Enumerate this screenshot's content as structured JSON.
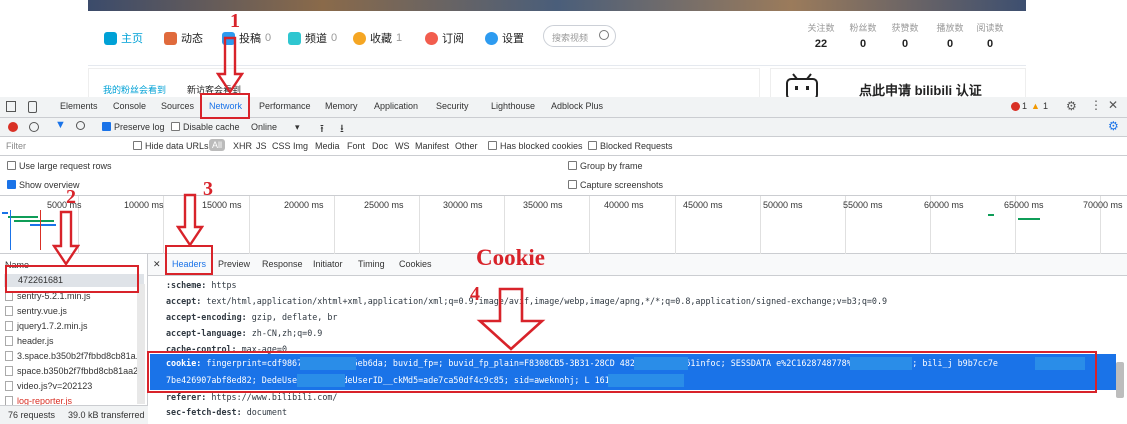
{
  "site": {
    "nav": [
      {
        "label": "主页",
        "count": "",
        "color": "#00a1d6",
        "icon": "home-icon"
      },
      {
        "label": "动态",
        "count": "",
        "color": "#e06a3c",
        "icon": "dynamic-icon"
      },
      {
        "label": "投稿",
        "count": "0",
        "color": "#2d9bf0",
        "icon": "upload-icon"
      },
      {
        "label": "频道",
        "count": "0",
        "color": "#2fc6d0",
        "icon": "channel-icon"
      },
      {
        "label": "收藏",
        "count": "1",
        "color": "#f5a623",
        "icon": "star-icon"
      },
      {
        "label": "订阅",
        "count": "",
        "color": "#f25d4e",
        "icon": "heart-icon"
      },
      {
        "label": "设置",
        "count": "",
        "color": "#2d9bf0",
        "icon": "gear-icon"
      }
    ],
    "search_placeholder": "搜索视频",
    "stats": [
      {
        "label": "关注数",
        "value": "22"
      },
      {
        "label": "粉丝数",
        "value": "0"
      },
      {
        "label": "获赞数",
        "value": "0"
      },
      {
        "label": "播放数",
        "value": "0"
      },
      {
        "label": "阅读数",
        "value": "0"
      }
    ],
    "left_tabs": [
      "我的粉丝会看到",
      "新访客会看到"
    ],
    "promo": "点此申请 bilibili 认证"
  },
  "devtools": {
    "tabs": [
      "Elements",
      "Console",
      "Sources",
      "Network",
      "Performance",
      "Memory",
      "Application",
      "Security",
      "Lighthouse",
      "Adblock Plus"
    ],
    "errors": "1",
    "warnings": "1",
    "preserve_log": "Preserve log",
    "disable_cache": "Disable cache",
    "throttle": "Online",
    "filter_placeholder": "Filter",
    "hide_data_urls": "Hide data URLs",
    "types": [
      "All",
      "XHR",
      "JS",
      "CSS",
      "Img",
      "Media",
      "Font",
      "Doc",
      "WS",
      "Manifest",
      "Other"
    ],
    "blocked_cookies": "Has blocked cookies",
    "blocked_requests": "Blocked Requests",
    "large_rows": "Use large request rows",
    "group_frame": "Group by frame",
    "show_overview": "Show overview",
    "capture": "Capture screenshots",
    "timeline": [
      "5000 ms",
      "10000 ms",
      "15000 ms",
      "20000 ms",
      "25000 ms",
      "30000 ms",
      "35000 ms",
      "40000 ms",
      "45000 ms",
      "50000 ms",
      "55000 ms",
      "60000 ms",
      "65000 ms",
      "70000 ms"
    ],
    "name_header": "Name",
    "requests": [
      "472261681",
      "sentry-5.2.1.min.js",
      "sentry.vue.js",
      "jquery1.7.2.min.js",
      "header.js",
      "3.space.b350b2f7fbbd8cb81a...",
      "space.b350b2f7fbbd8cb81aa2...",
      "video.js?v=202123",
      "log-reporter.js"
    ],
    "detail_tabs": [
      "Headers",
      "Preview",
      "Response",
      "Initiator",
      "Timing",
      "Cookies"
    ],
    "headers": [
      {
        "k": ":scheme:",
        "v": "https"
      },
      {
        "k": "accept:",
        "v": "text/html,application/xhtml+xml,application/xml;q=0.9,image/avif,image/webp,image/apng,*/*;q=0.8,application/signed-exchange;v=b3;q=0.9"
      },
      {
        "k": "accept-encoding:",
        "v": "gzip, deflate, br"
      },
      {
        "k": "accept-language:",
        "v": "zh-CN,zh;q=0.9"
      },
      {
        "k": "cache-control:",
        "v": "max-age=0"
      }
    ],
    "cookie_key": "cookie:",
    "cookie_line1": "fingerprint=cdf9867dd          b6a47da5eb6da; buvid_fp=; buvid_fp_plain=F8308CB5-3B31-28CD          482A58164E20161infoc; SESSDATA          e%2C1628748778%2C02f8e%2A21; bili_j          b9b7cc7e",
    "cookie_line2": "7be426907abf8ed82; DedeUser          581; DedeUserID__ckMd5=ade7ca50df4c9c85; sid=aweknohj; L                    16131967789259",
    "after": [
      {
        "k": "referer:",
        "v": "https://www.bilibili.com/"
      },
      {
        "k": "sec-fetch-dest:",
        "v": "document"
      }
    ],
    "status_requests": "76 requests",
    "status_transferred": "39.0 kB transferred"
  },
  "annotations": {
    "n1": "1",
    "n2": "2",
    "n3": "3",
    "n4": "4",
    "cookie": "Cookie"
  }
}
